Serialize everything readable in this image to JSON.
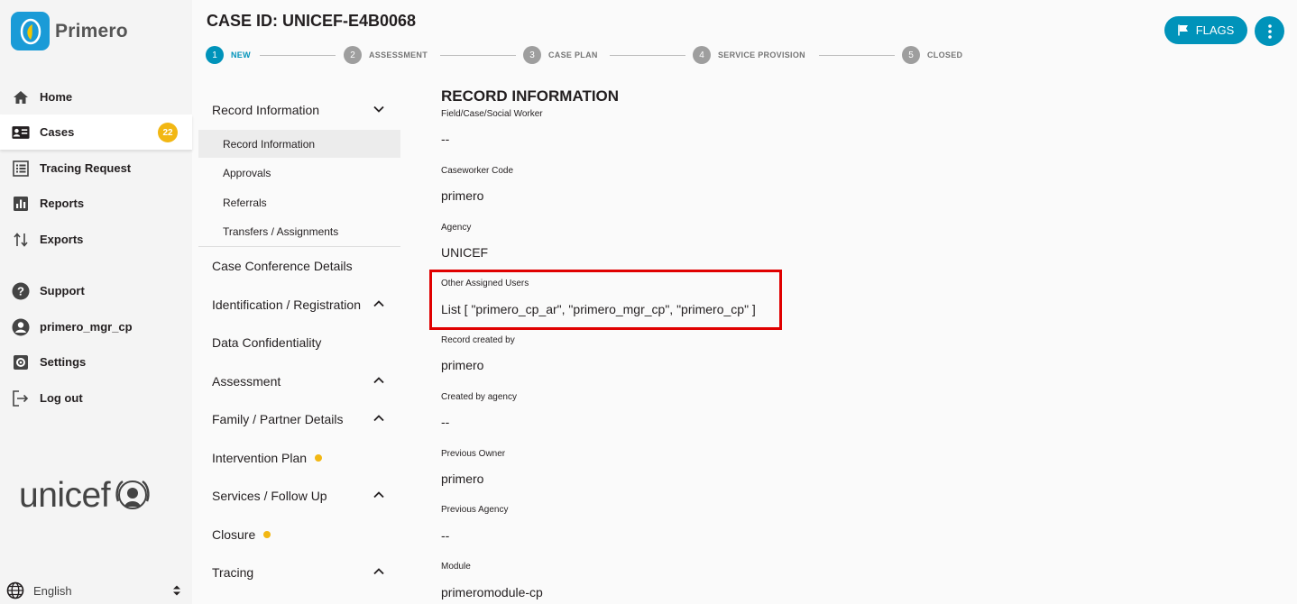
{
  "app": {
    "name": "Primero",
    "org_logo_text": "unicef"
  },
  "sidebar": {
    "items": [
      {
        "label": "Home",
        "icon": "home-icon"
      },
      {
        "label": "Cases",
        "icon": "case-card-icon",
        "badge": "22",
        "active": true
      },
      {
        "label": "Tracing Request",
        "icon": "list-icon"
      },
      {
        "label": "Reports",
        "icon": "bar-chart-icon"
      },
      {
        "label": "Exports",
        "icon": "swap-vertical-icon"
      },
      {
        "label": "Support",
        "icon": "help-icon"
      },
      {
        "label": "primero_mgr_cp",
        "icon": "account-icon"
      },
      {
        "label": "Settings",
        "icon": "settings-icon"
      },
      {
        "label": "Log out",
        "icon": "logout-icon"
      }
    ],
    "language": "English"
  },
  "header": {
    "title": "CASE ID: UNICEF-E4B0068",
    "flags_label": "FLAGS"
  },
  "stepper": [
    {
      "num": "1",
      "label": "NEW"
    },
    {
      "num": "2",
      "label": "ASSESSMENT"
    },
    {
      "num": "3",
      "label": "CASE PLAN"
    },
    {
      "num": "4",
      "label": "SERVICE PROVISION"
    },
    {
      "num": "5",
      "label": "CLOSED"
    }
  ],
  "forms_nav": {
    "record_information": "Record Information",
    "sub_items": [
      "Record Information",
      "Approvals",
      "Referrals",
      "Transfers / Assignments"
    ],
    "groups": [
      "Case Conference Details",
      "Identification / Registration",
      "Data Confidentiality",
      "Assessment",
      "Family / Partner Details",
      "Intervention Plan",
      "Services / Follow Up",
      "Closure",
      "Tracing"
    ]
  },
  "record": {
    "section_title": "RECORD INFORMATION",
    "fields": [
      {
        "label": "Field/Case/Social Worker",
        "value": "--"
      },
      {
        "label": "Caseworker Code",
        "value": "primero"
      },
      {
        "label": "Agency",
        "value": "UNICEF"
      },
      {
        "label": "Other Assigned Users",
        "value": "List [ \"primero_cp_ar\", \"primero_mgr_cp\", \"primero_cp\" ]"
      },
      {
        "label": "Record created by",
        "value": "primero"
      },
      {
        "label": "Created by agency",
        "value": "--"
      },
      {
        "label": "Previous Owner",
        "value": "primero"
      },
      {
        "label": "Previous Agency",
        "value": "--"
      },
      {
        "label": "Module",
        "value": "primeromodule-cp"
      }
    ]
  },
  "colors": {
    "accent": "#0093ba",
    "badge": "#f2b713",
    "highlight": "#e00000"
  }
}
